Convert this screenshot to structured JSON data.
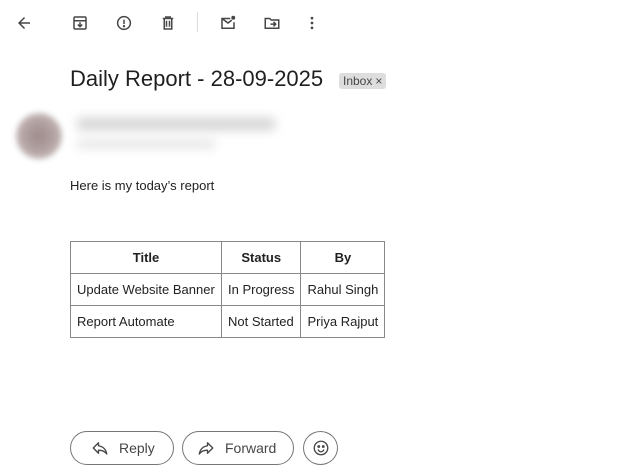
{
  "toolbar": {
    "icons": [
      "back-arrow-icon",
      "archive-icon",
      "report-spam-icon",
      "delete-icon",
      "mark-unread-icon",
      "move-to-icon",
      "more-options-icon"
    ]
  },
  "email": {
    "subject": "Daily Report - 28-09-2025",
    "label": "Inbox",
    "label_close": "×",
    "body_text": "Here is my today’s report",
    "table": {
      "headers": [
        "Title",
        "Status",
        "By"
      ],
      "rows": [
        [
          "Update Website Banner",
          "In Progress",
          "Rahul Singh"
        ],
        [
          "Report Automate",
          "Not Started",
          "Priya Rajput"
        ]
      ]
    }
  },
  "actions": {
    "reply_label": "Reply",
    "forward_label": "Forward"
  },
  "colors": {
    "icon": "#444746",
    "chip_bg": "#dddddd",
    "border": "#747775"
  }
}
